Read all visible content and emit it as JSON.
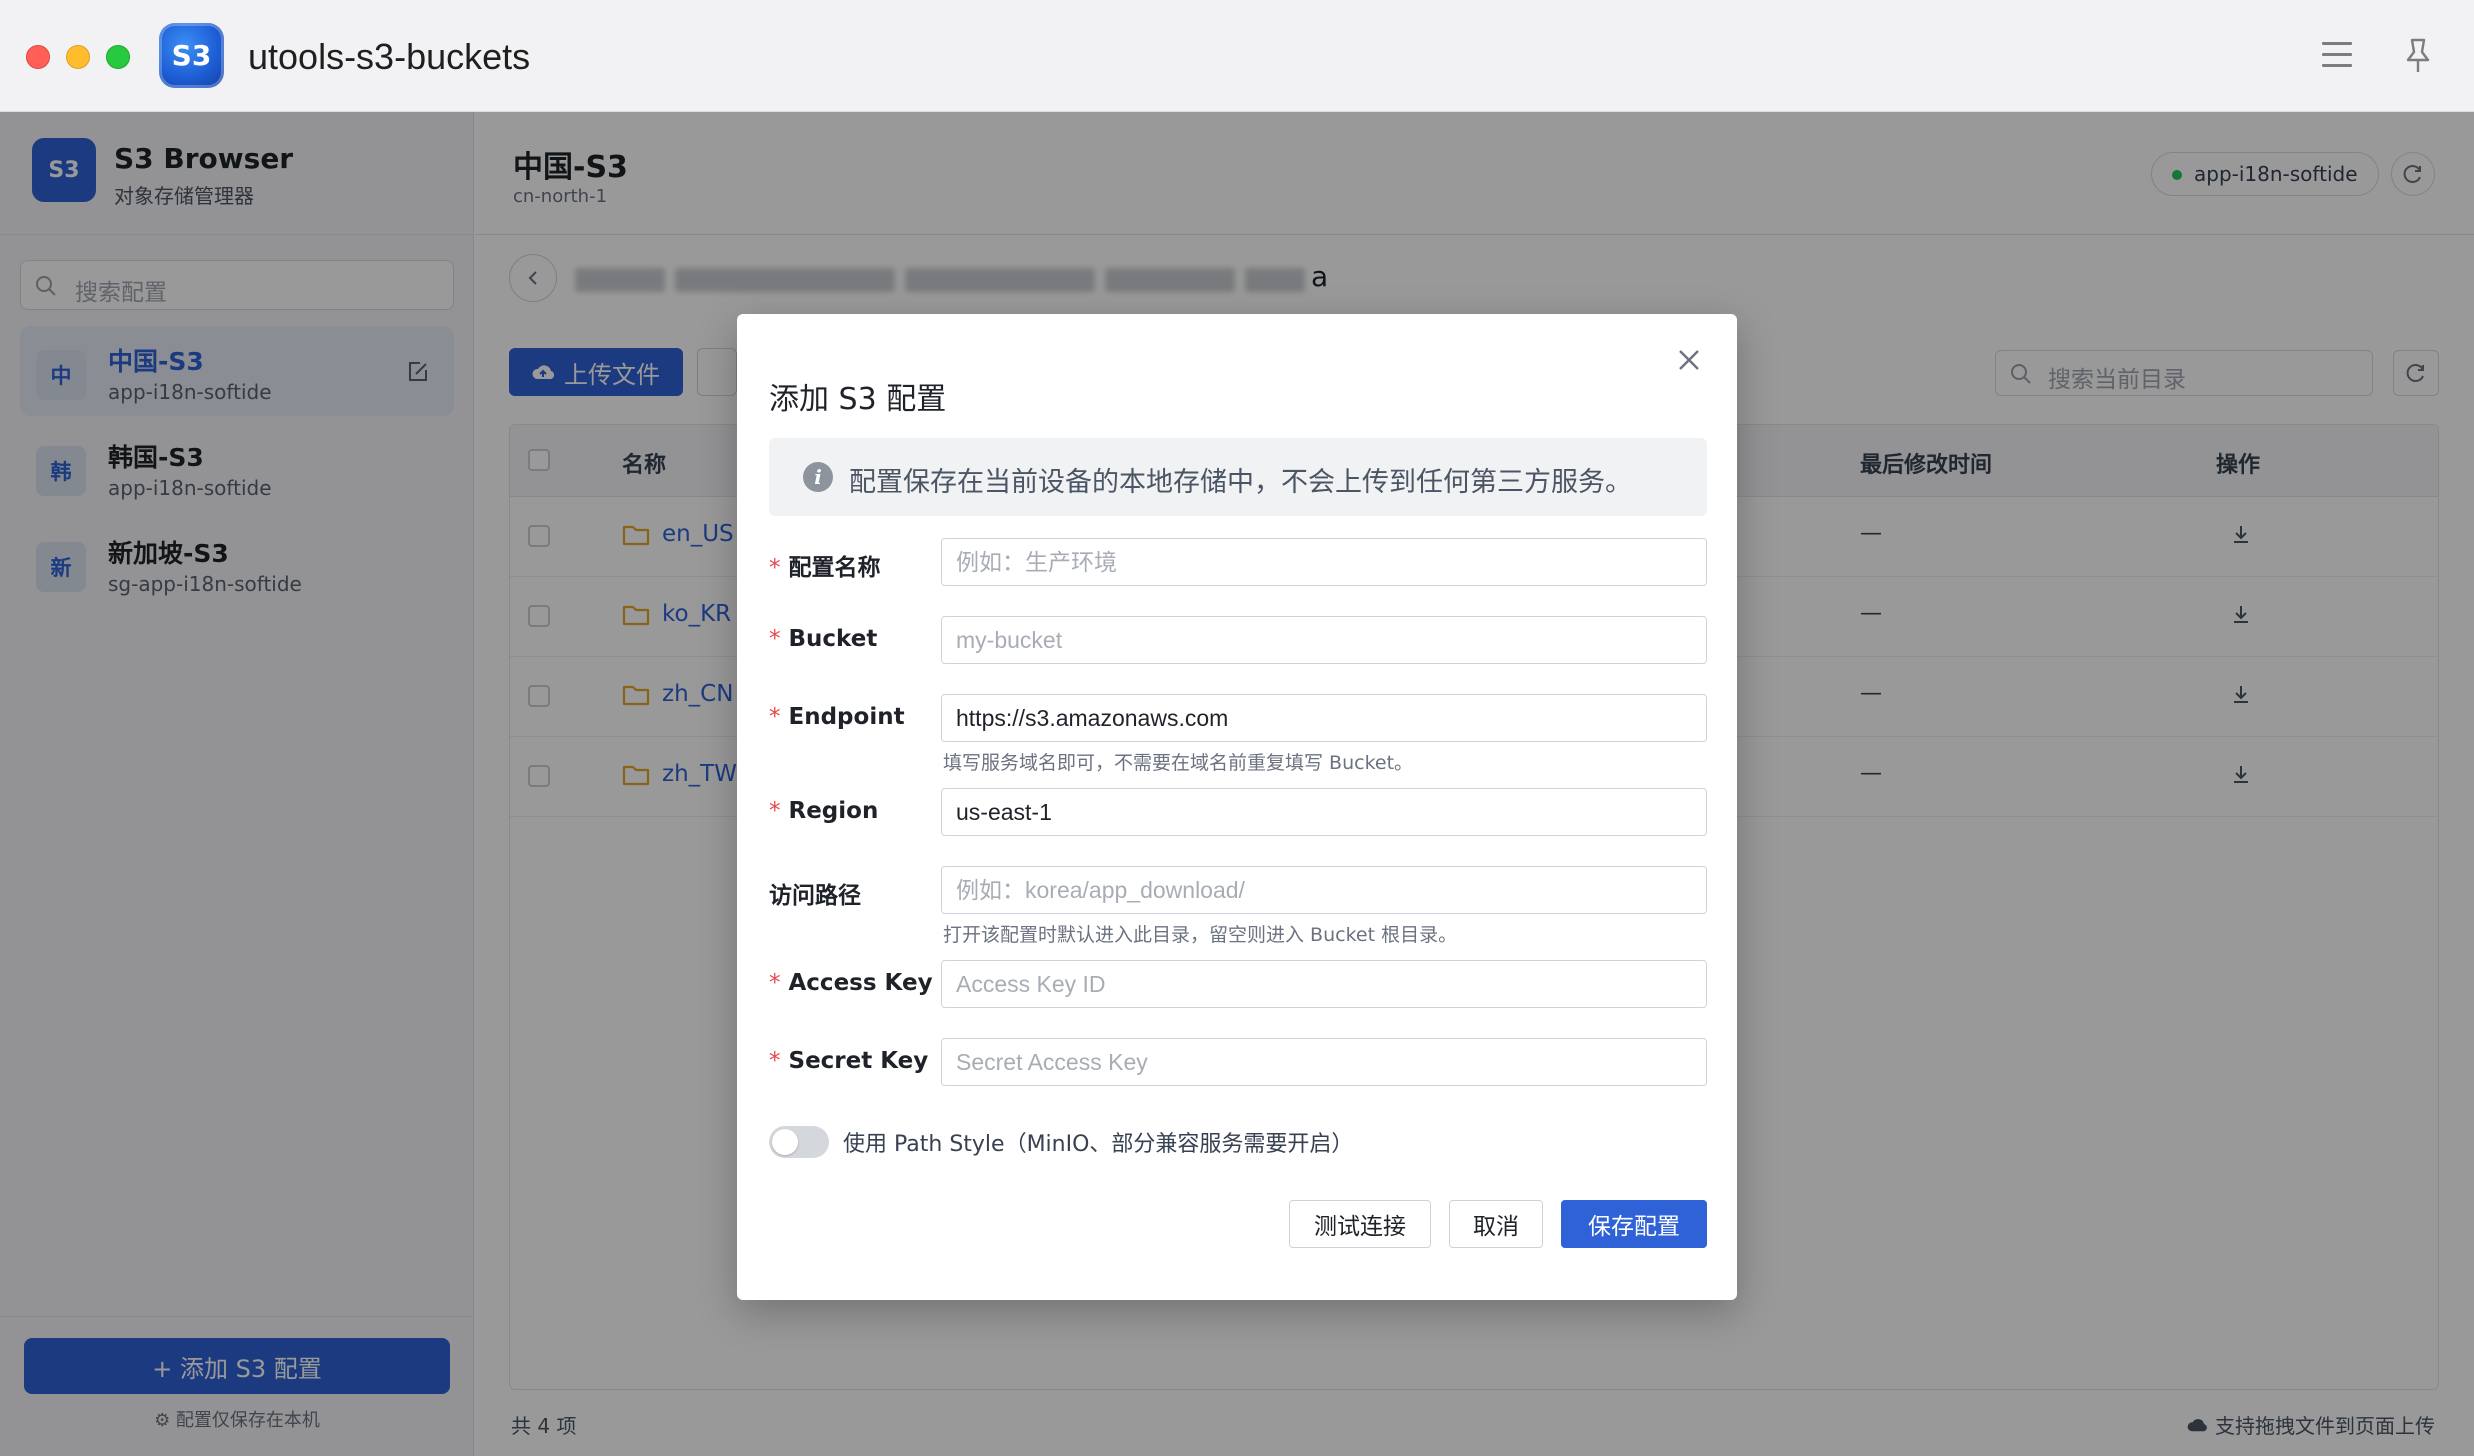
{
  "window": {
    "title": "utools-s3-buckets",
    "logo_text": "S3"
  },
  "sidebar": {
    "brand_logo": "S3",
    "brand_title": "S3 Browser",
    "brand_subtitle": "对象存储管理器",
    "search_placeholder": "搜索配置",
    "configs": [
      {
        "avatar": "中",
        "name": "中国-S3",
        "profile": "app-i18n-softide",
        "active": true
      },
      {
        "avatar": "韩",
        "name": "韩国-S3",
        "profile": "app-i18n-softide",
        "active": false
      },
      {
        "avatar": "新",
        "name": "新加坡-S3",
        "profile": "sg-app-i18n-softide",
        "active": false
      }
    ],
    "add_button": "+ 添加 S3 配置",
    "footer_note": "配置仅保存在本机"
  },
  "main": {
    "title": "中国-S3",
    "region": "cn-north-1",
    "profile_badge": "app-i18n-softide",
    "path_suffix": "a",
    "upload_button": "上传文件",
    "search_placeholder": "搜索当前目录",
    "table": {
      "columns": [
        "名称",
        "最后修改时间",
        "操作"
      ],
      "rows": [
        {
          "name": "en_US",
          "modified": "—"
        },
        {
          "name": "ko_KR",
          "modified": "—"
        },
        {
          "name": "zh_CN",
          "modified": "—"
        },
        {
          "name": "zh_TW",
          "modified": "—"
        }
      ]
    },
    "total": "共 4 项",
    "drag_note": "支持拖拽文件到页面上传"
  },
  "modal": {
    "title": "添加 S3 配置",
    "info": "配置保存在当前设备的本地存储中，不会上传到任何第三方服务。",
    "fields": {
      "name": {
        "label": "配置名称",
        "required": true,
        "value": "",
        "placeholder": "例如：生产环境"
      },
      "bucket": {
        "label": "Bucket",
        "required": true,
        "value": "",
        "placeholder": "my-bucket"
      },
      "endpoint": {
        "label": "Endpoint",
        "required": true,
        "value": "https://s3.amazonaws.com",
        "help": "填写服务域名即可，不需要在域名前重复填写 Bucket。"
      },
      "region": {
        "label": "Region",
        "required": true,
        "value": "us-east-1"
      },
      "path": {
        "label": "访问路径",
        "required": false,
        "value": "",
        "placeholder": "例如：korea/app_download/",
        "help": "打开该配置时默认进入此目录，留空则进入 Bucket 根目录。"
      },
      "access_key": {
        "label": "Access Key",
        "required": true,
        "value": "",
        "placeholder": "Access Key ID"
      },
      "secret_key": {
        "label": "Secret Key",
        "required": true,
        "value": "",
        "placeholder": "Secret Access Key"
      }
    },
    "path_style_toggle": {
      "label": "使用 Path Style（MinIO、部分兼容服务需要开启）",
      "on": false
    },
    "buttons": {
      "test": "测试连接",
      "cancel": "取消",
      "save": "保存配置"
    }
  },
  "colors": {
    "primary": "#2f62d6",
    "required": "#e5484d",
    "folder": "#e3a728",
    "status_dot": "#22c55e"
  }
}
